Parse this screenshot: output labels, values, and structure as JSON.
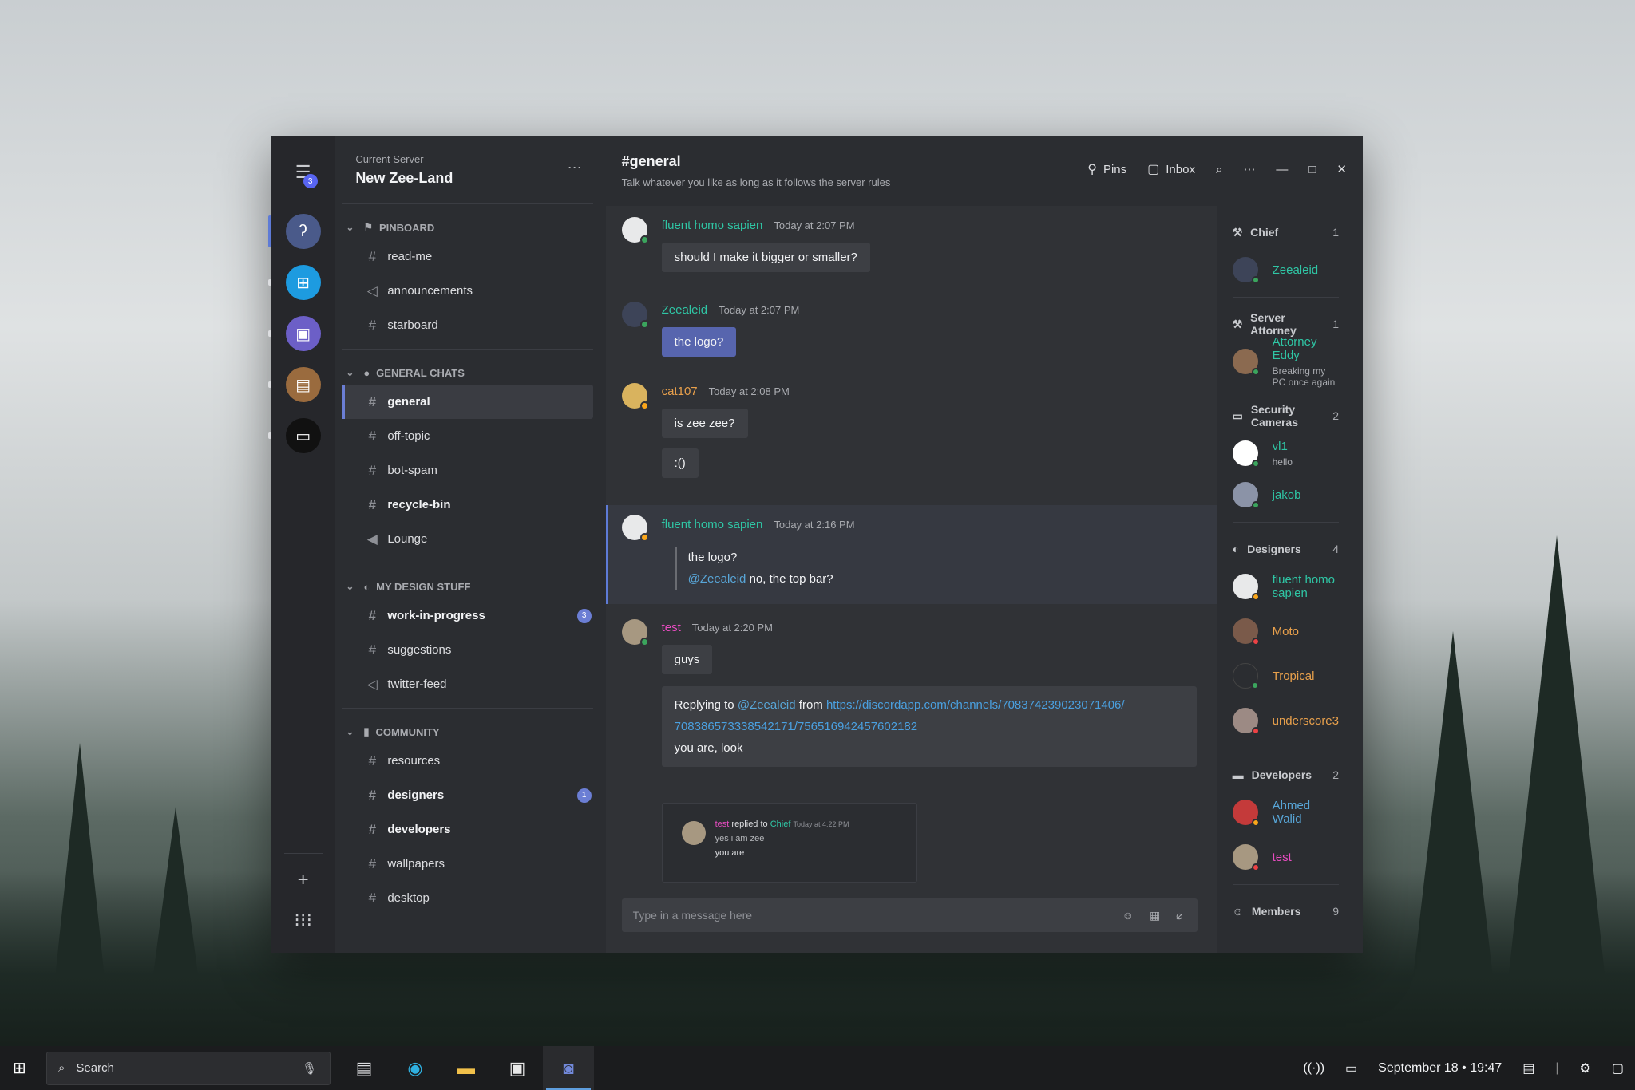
{
  "colors": {
    "window_bg": "#2b2d31",
    "chat_bg": "#303236",
    "accent": "#5e7bd6",
    "username_teal": "#2fc6a5",
    "username_pink": "#e84cc1",
    "username_orange": "#e8a04c",
    "username_blue": "#58a6d8",
    "status_online": "#3ba55d",
    "status_idle": "#faa61a",
    "status_dnd": "#ed4245"
  },
  "server_header": {
    "caption": "Current Server",
    "name": "New Zee-Land",
    "menu_badge": "3"
  },
  "categories": [
    {
      "name": "PINBOARD",
      "icon": "flag-icon",
      "channels": [
        {
          "name": "read-me",
          "icon": "hash-icon"
        },
        {
          "name": "announcements",
          "icon": "megaphone-icon"
        },
        {
          "name": "starboard",
          "icon": "hash-icon"
        }
      ]
    },
    {
      "name": "GENERAL CHATS",
      "icon": "speech-bubble-icon",
      "channels": [
        {
          "name": "general",
          "icon": "hash-icon"
        },
        {
          "name": "off-topic",
          "icon": "hash-icon"
        },
        {
          "name": "bot-spam",
          "icon": "hash-icon"
        },
        {
          "name": "recycle-bin",
          "icon": "hash-icon"
        },
        {
          "name": "Lounge",
          "icon": "speaker-icon"
        }
      ]
    },
    {
      "name": "MY DESIGN STUFF",
      "icon": "palette-icon",
      "channels": [
        {
          "name": "work-in-progress",
          "icon": "hash-icon",
          "badge": "3"
        },
        {
          "name": "suggestions",
          "icon": "hash-icon"
        },
        {
          "name": "twitter-feed",
          "icon": "megaphone-icon"
        }
      ]
    },
    {
      "name": "COMMUNITY",
      "icon": "scroll-icon",
      "channels": [
        {
          "name": "resources",
          "icon": "hash-icon"
        },
        {
          "name": "designers",
          "icon": "hash-icon",
          "badge": "1"
        },
        {
          "name": "developers",
          "icon": "hash-icon"
        },
        {
          "name": "wallpapers",
          "icon": "hash-icon"
        },
        {
          "name": "desktop",
          "icon": "hash-icon"
        }
      ]
    }
  ],
  "channel_header": {
    "title": "#general",
    "topic": "Talk whatever you like as long as it follows the server rules",
    "pins_label": "Pins",
    "inbox_label": "Inbox"
  },
  "messages": [
    {
      "author": "fluent homo sapien",
      "time": "Today at 2:07 PM",
      "text": "should I make it bigger or smaller?"
    },
    {
      "author": "Zeealeid",
      "time": "Today at 2:07 PM",
      "text": "the logo?"
    },
    {
      "author": "cat107",
      "time": "Today at 2:08 PM",
      "lines": [
        "is zee zee?",
        ":()"
      ]
    },
    {
      "author": "fluent homo sapien",
      "time": "Today at 2:16 PM",
      "quote": "the logo?",
      "mention": "@Zeealeid",
      "reply": "no, the top bar?"
    },
    {
      "author": "test",
      "time": "Today at 2:20 PM",
      "text": "guys",
      "reply_prefix": "Replying to",
      "reply_mention": "@Zeealeid",
      "reply_from": "from",
      "reply_link_1": "https://discordapp.com/channels/708374239023071406/",
      "reply_link_2": "708386573338542171/756516942457602182",
      "reply_body": "you are, look",
      "card": {
        "author": "test",
        "action": "replied to",
        "target": "Chief",
        "time": "Today at 4:22 PM",
        "quoted": "yes i am zee",
        "body": "you are"
      }
    }
  ],
  "composer": {
    "placeholder": "Type in a message here"
  },
  "member_roles": [
    {
      "name": "Chief",
      "count": "1",
      "icon": "hammer-icon",
      "members": [
        {
          "name": "Zeealeid"
        }
      ]
    },
    {
      "name": "Server Attorney",
      "count": "1",
      "icon": "hammer-icon",
      "members": [
        {
          "name": "Attorney Eddy",
          "sub": "Breaking my PC once again"
        }
      ]
    },
    {
      "name": "Security Cameras",
      "count": "2",
      "icon": "camera-icon",
      "members": [
        {
          "name": "vl1",
          "sub": "hello"
        },
        {
          "name": "jakob"
        }
      ]
    },
    {
      "name": "Designers",
      "count": "4",
      "icon": "palette-icon",
      "members": [
        {
          "name": "fluent homo sapien"
        },
        {
          "name": "Moto"
        },
        {
          "name": "Tropical"
        },
        {
          "name": "underscore3"
        }
      ]
    },
    {
      "name": "Developers",
      "count": "2",
      "icon": "laptop-icon",
      "members": [
        {
          "name": "Ahmed Walid"
        },
        {
          "name": "test"
        }
      ]
    },
    {
      "name": "Members",
      "count": "9",
      "icon": "smiley-icon"
    }
  ],
  "taskbar": {
    "search_label": "Search",
    "date": "September 18",
    "separator": "•",
    "time": "19:47"
  }
}
